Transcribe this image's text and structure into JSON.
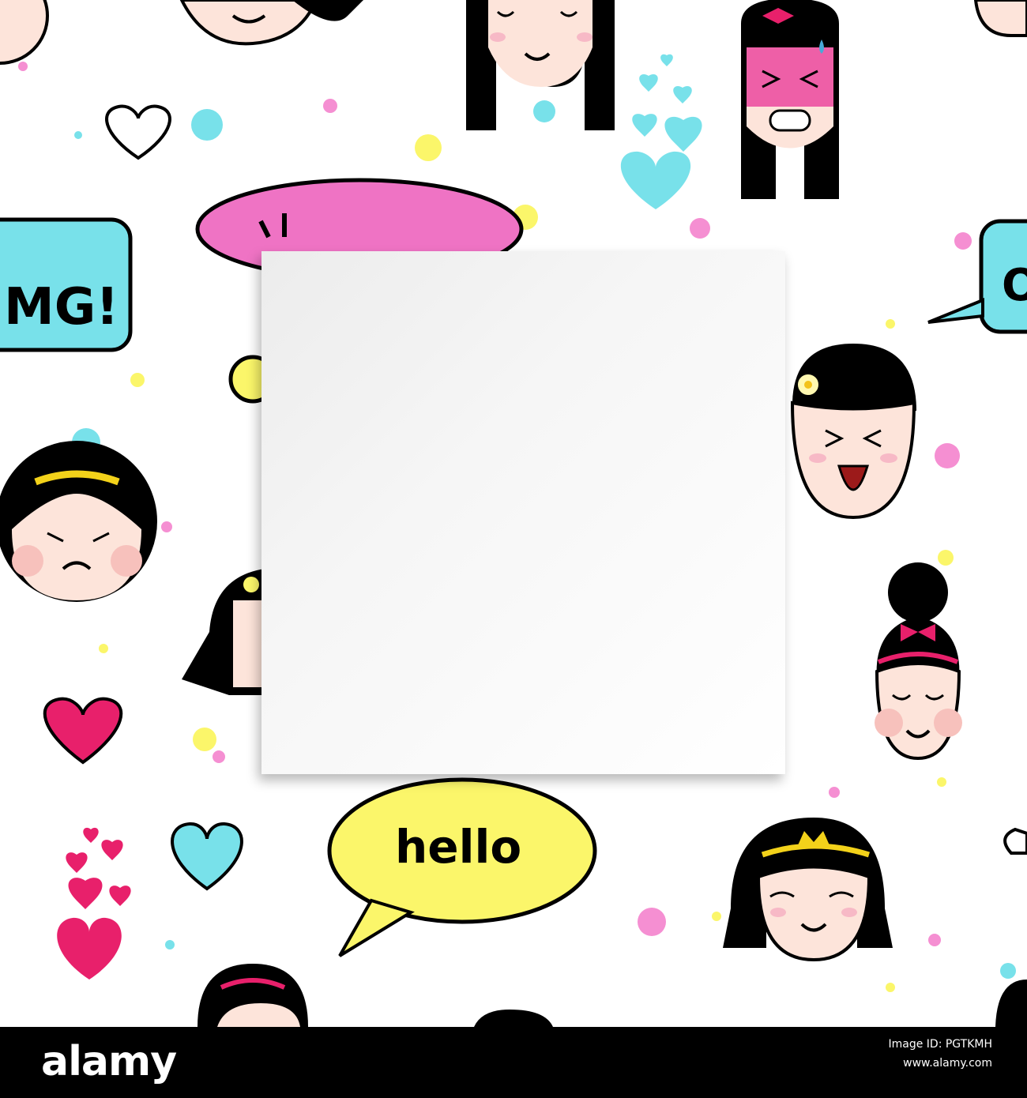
{
  "colors": {
    "pink": "#ef73c4",
    "light_pink": "#f58fd2",
    "cyan": "#78e1ea",
    "yellow": "#fbf66a",
    "red_heart": "#e8206b",
    "hair": "#000000",
    "skin": "#fde4da",
    "blush": "#f7b9c6"
  },
  "speech_bubbles": {
    "omg": "MG!",
    "hello": "hello",
    "right_partial": "O"
  },
  "footer": {
    "logo": "alamy",
    "image_id_label": "Image ID: PGTKMH",
    "site": "www.alamy.com"
  }
}
